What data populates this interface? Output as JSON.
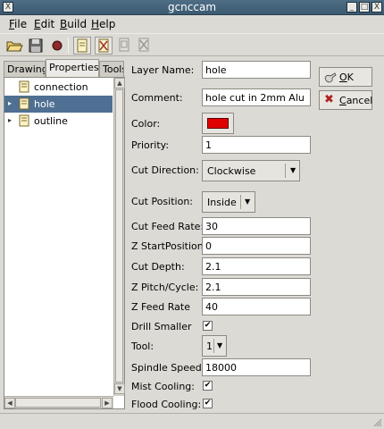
{
  "window": {
    "title": "gcnccam",
    "close_glyph": "X",
    "minimize_glyph": "_",
    "maximize_glyph": "□",
    "titlebar_color": "#456379"
  },
  "menu": {
    "items": [
      {
        "pre": "",
        "accel": "F",
        "post": "ile"
      },
      {
        "pre": "",
        "accel": "E",
        "post": "dit"
      },
      {
        "pre": "",
        "accel": "B",
        "post": "uild"
      },
      {
        "pre": "",
        "accel": "H",
        "post": "elp"
      }
    ]
  },
  "toolbar": {
    "icons": [
      "open-folder-icon",
      "save-disk-icon",
      "record-icon",
      "layer-new-icon",
      "layer-delete-icon",
      "layer-copy-icon",
      "layer-cut-icon"
    ]
  },
  "tabs": [
    "Drawing",
    "Properties",
    "Tools"
  ],
  "tree": {
    "items": [
      {
        "label": "connection",
        "expander": ""
      },
      {
        "label": "hole",
        "expander": "▸"
      },
      {
        "label": "outline",
        "expander": "▸"
      }
    ],
    "selected_color": "#4f7092"
  },
  "properties": {
    "layer_name": {
      "label": "Layer Name:",
      "value": "hole"
    },
    "comment": {
      "label": "Comment:",
      "value": "hole cut in 2mm Alu"
    },
    "color": {
      "label": "Color:",
      "value": "#e00000"
    },
    "priority": {
      "label": "Priority:",
      "value": "1"
    },
    "cut_direction": {
      "label": "Cut Direction:",
      "value": "Clockwise"
    },
    "cut_position": {
      "label": "Cut Position:",
      "value": "Inside"
    },
    "cut_feed_rate": {
      "label": "Cut Feed Rate:",
      "value": "30"
    },
    "z_start_position": {
      "label": "Z StartPosition:",
      "value": "0"
    },
    "cut_depth": {
      "label": "Cut Depth:",
      "value": "2.1"
    },
    "z_pitch_cycle": {
      "label": "Z Pitch/Cycle:",
      "value": "2.1"
    },
    "z_feed_rate": {
      "label": "Z Feed Rate",
      "value": "40"
    },
    "drill_smaller": {
      "label": "Drill Smaller",
      "checked": true,
      "mark": "✔"
    },
    "tool": {
      "label": "Tool:",
      "value": "1"
    },
    "spindle_speed": {
      "label": "Spindle Speed:",
      "value": "18000"
    },
    "mist_cooling": {
      "label": "Mist Cooling:",
      "checked": true,
      "mark": "✔"
    },
    "flood_cooling": {
      "label": "Flood Cooling:",
      "checked": true,
      "mark": "✔"
    }
  },
  "buttons": {
    "ok": {
      "label": "OK",
      "accel": "O",
      "rest": "K",
      "icon": "ok-hand-icon"
    },
    "cancel": {
      "label": "Cancel",
      "accel": "C",
      "rest": "ancel",
      "icon": "cancel-x-icon"
    }
  }
}
